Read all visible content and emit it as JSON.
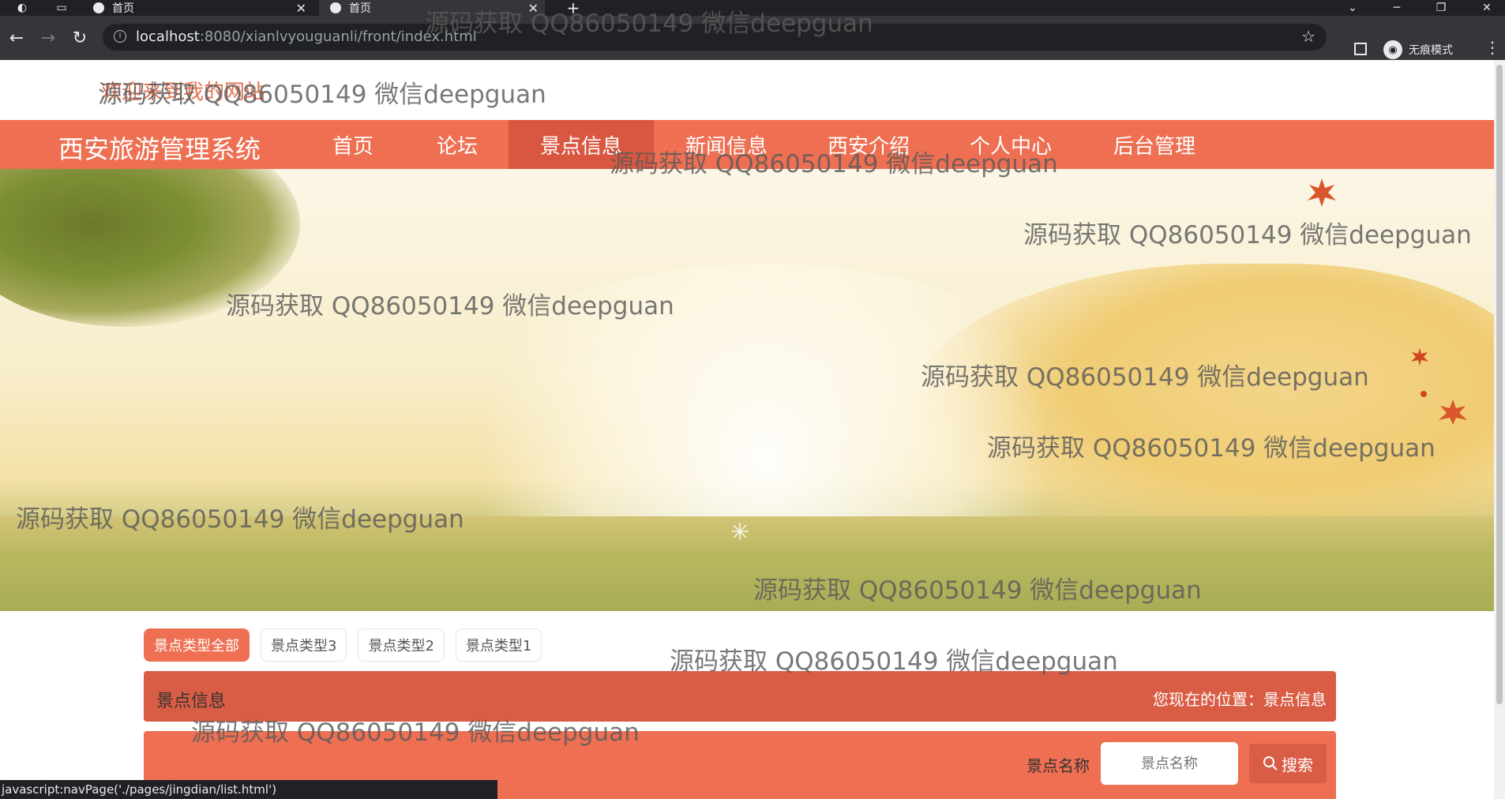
{
  "browser": {
    "tabs": [
      {
        "title": "首页"
      },
      {
        "title": "首页"
      }
    ],
    "new_tab": "+",
    "url_host": "localhost",
    "url_rest": ":8080/xianlvyouguanli/front/index.html",
    "incognito_label": "无痕模式"
  },
  "header": {
    "welcome": "欢迎来到我的网站",
    "brand": "西安旅游管理系统",
    "nav": [
      "首页",
      "论坛",
      "景点信息",
      "新闻信息",
      "西安介绍",
      "个人中心",
      "后台管理"
    ],
    "active_nav": "景点信息"
  },
  "categories": {
    "items": [
      "景点类型全部",
      "景点类型3",
      "景点类型2",
      "景点类型1"
    ],
    "active": "景点类型全部"
  },
  "section": {
    "title": "景点信息",
    "location": "您现在的位置：景点信息"
  },
  "search": {
    "label": "景点名称",
    "placeholder": "景点名称",
    "button": "搜索"
  },
  "status_bar": "javascript:navPage('./pages/jingdian/list.html')",
  "watermark": "源码获取 QQ86050149 微信deepguan",
  "colors": {
    "accent": "#ee6f52",
    "accent_dark": "#d95d45"
  }
}
